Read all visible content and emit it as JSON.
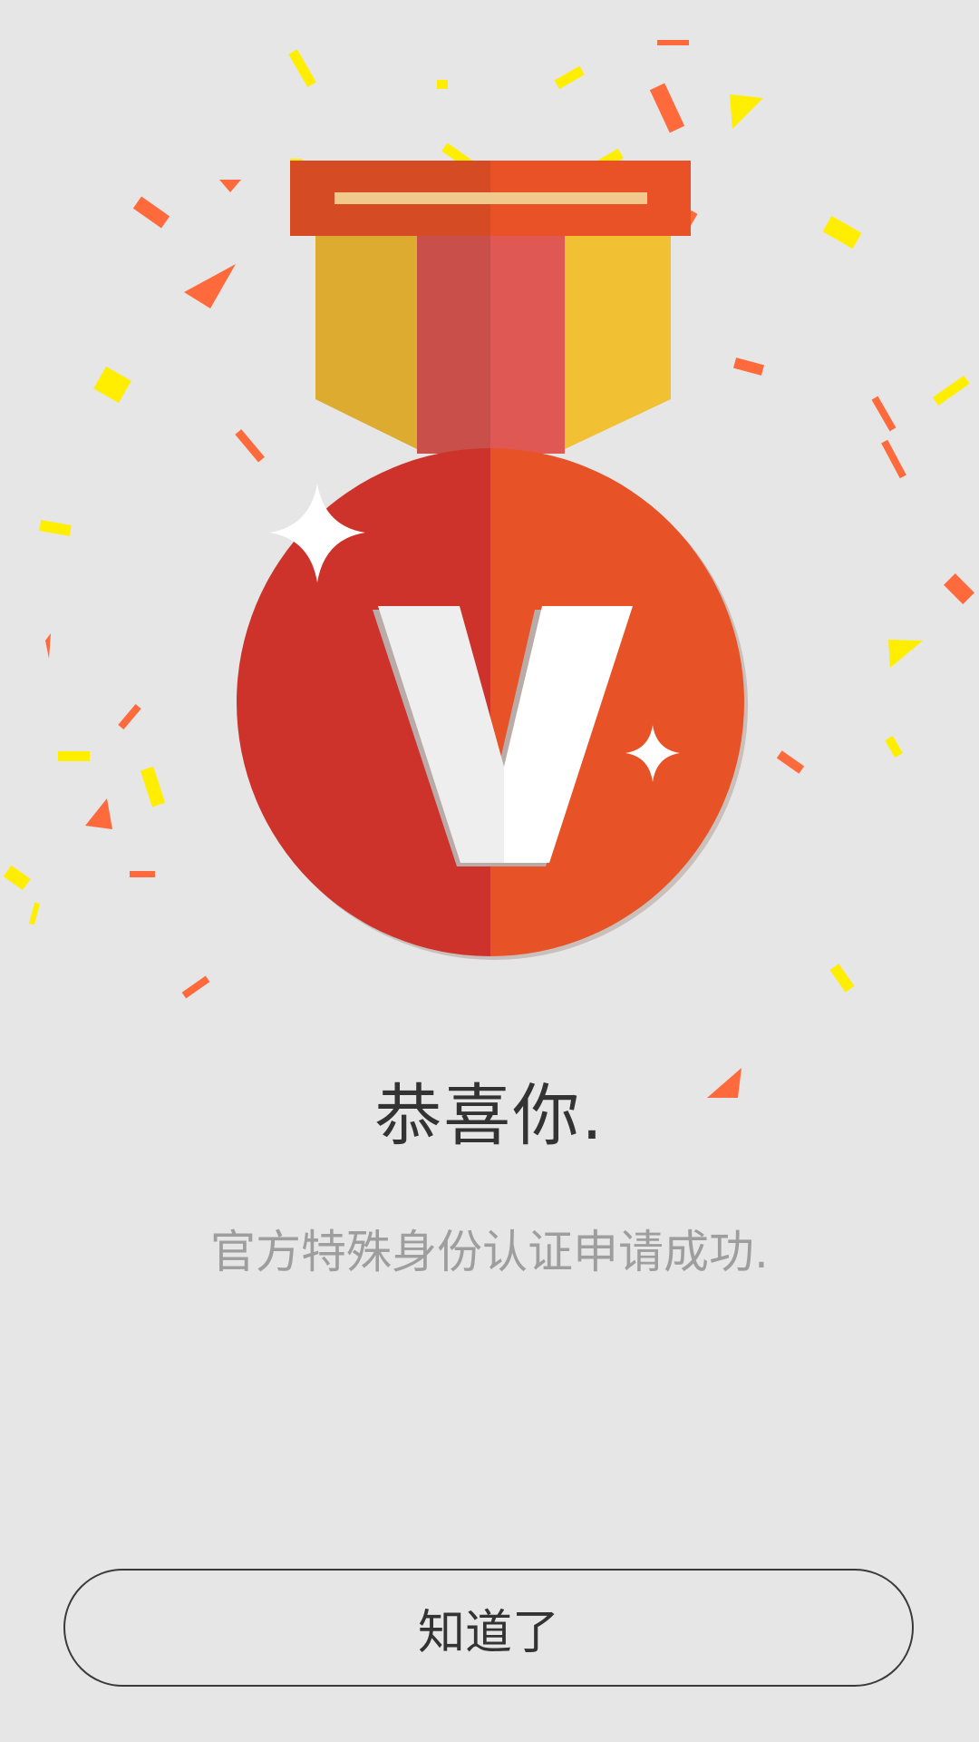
{
  "dialog": {
    "title": "恭喜你.",
    "message": "官方特殊身份认证申请成功.",
    "confirm_label": "知道了"
  },
  "medal": {
    "letter": "V",
    "colors": {
      "disc_left": "#cd332b",
      "disc_right": "#e75227",
      "ribbon_gold_left": "#dcab30",
      "ribbon_gold_right": "#f1c133",
      "ribbon_red_left": "#c94f4b",
      "ribbon_red_right": "#df5853",
      "clasp_left": "#d44b24",
      "clasp_right": "#e95126",
      "clasp_bar": "#f2c98d"
    }
  },
  "confetti_colors": [
    "#ffee00",
    "#ff6a3d"
  ],
  "background_color": "#e6e6e6"
}
